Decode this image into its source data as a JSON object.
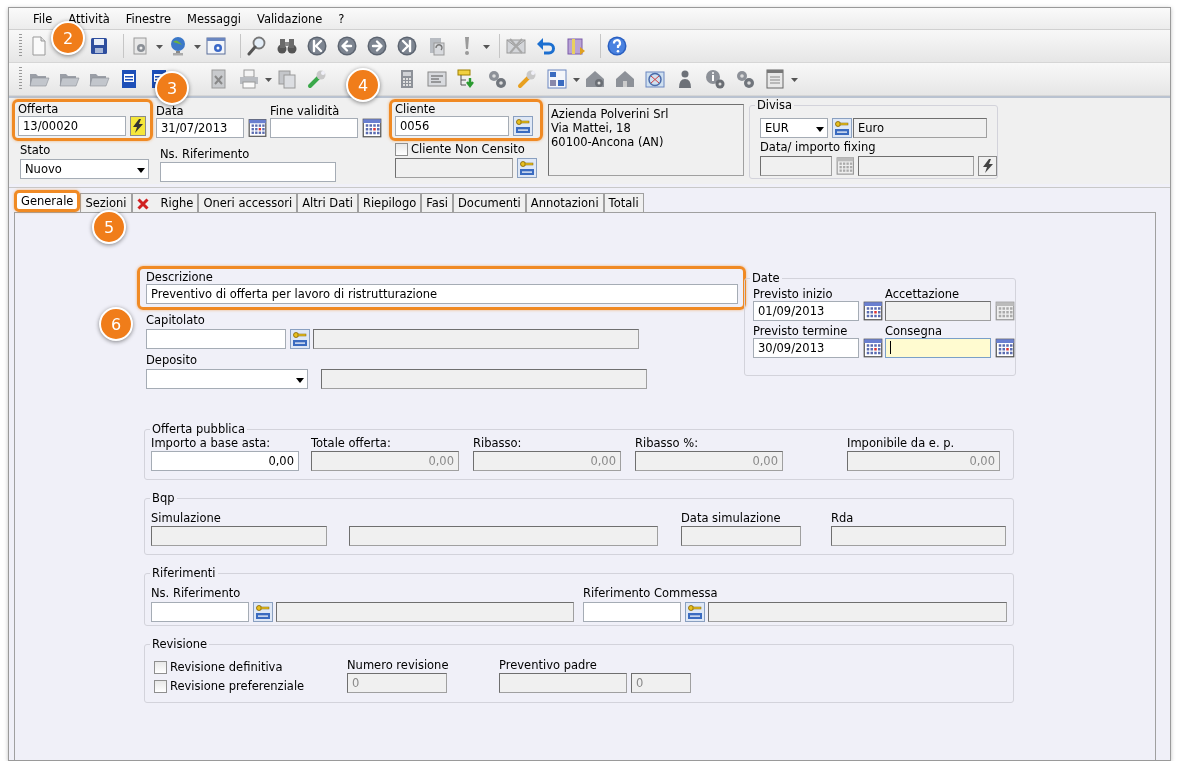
{
  "menu": [
    {
      "label": "File"
    },
    {
      "label": "Attività"
    },
    {
      "label": "Finestre"
    },
    {
      "label": "Messaggi"
    },
    {
      "label": "Validazione"
    },
    {
      "label": "?"
    }
  ],
  "header": {
    "offerta": {
      "label": "Offerta",
      "value": "13/00020",
      "highlighted": true
    },
    "data": {
      "label": "Data",
      "value": "31/07/2013"
    },
    "fine_validita": {
      "label": "Fine validità"
    },
    "cliente": {
      "label": "Cliente",
      "value": "0056",
      "highlighted": true
    },
    "address": [
      "Azienda Polverini Srl",
      "Via Mattei, 18",
      "60100-Ancona (AN)"
    ],
    "stato": {
      "label": "Stato",
      "value": "Nuovo"
    },
    "ns_riferimento": {
      "label": "Ns. Riferimento"
    },
    "cliente_non_censito": {
      "label": "Cliente Non Censito",
      "checked": false
    },
    "divisa": {
      "title": "Divisa",
      "currency": "EUR",
      "currency_name": "Euro",
      "fixing_label": "Data/ importo fixing"
    }
  },
  "tabs": [
    {
      "label": "Generale",
      "selected": true,
      "highlighted": true
    },
    {
      "label": "Sezioni",
      "selected": false,
      "highlighted": false
    },
    {
      "label": "Righe",
      "selected": false,
      "highlighted": false,
      "kind": "delete"
    },
    {
      "label": "Oneri accessori",
      "selected": false,
      "highlighted": false
    },
    {
      "label": "Altri Dati",
      "selected": false,
      "highlighted": false
    },
    {
      "label": "Riepilogo",
      "selected": false,
      "highlighted": false
    },
    {
      "label": "Fasi",
      "selected": false,
      "highlighted": false
    },
    {
      "label": "Documenti",
      "selected": false,
      "highlighted": false
    },
    {
      "label": "Annotazioni",
      "selected": false,
      "highlighted": false
    },
    {
      "label": "Totali",
      "selected": false,
      "highlighted": false
    }
  ],
  "general": {
    "descrizione": {
      "label": "Descrizione",
      "value": "Preventivo di offerta per lavoro di ristrutturazione",
      "highlighted": true
    },
    "capitolato": {
      "label": "Capitolato"
    },
    "deposito": {
      "label": "Deposito"
    },
    "date": {
      "title": "Date",
      "fields": [
        {
          "label": "Previsto inizio",
          "value": "01/09/2013",
          "disabled": false,
          "focused": false
        },
        {
          "label": "Accettazione",
          "disabled": true,
          "focused": false
        },
        {
          "label": "Previsto termine",
          "value": "30/09/2013",
          "disabled": false,
          "focused": false
        },
        {
          "label": "Consegna",
          "disabled": false,
          "focused": true
        }
      ]
    },
    "offerta_pubblica": {
      "title": "Offerta pubblica",
      "fields": [
        {
          "label": "Importo a base asta:",
          "value": "0,00",
          "disabled": false
        },
        {
          "label": "Totale offerta:",
          "value": "0,00",
          "disabled": true
        },
        {
          "label": "Ribasso:",
          "value": "0,00",
          "disabled": true
        },
        {
          "label": "Ribasso %:",
          "value": "0,00",
          "disabled": true
        },
        {
          "label": "Imponibile da e. p.",
          "value": "0,00",
          "disabled": true
        }
      ]
    },
    "bqp": {
      "title": "Bqp",
      "simulazione": "Simulazione",
      "data_simulazione": "Data simulazione",
      "rda": "Rda"
    },
    "riferimenti": {
      "title": "Riferimenti",
      "ns_riferimento": "Ns. Riferimento",
      "riferimento_commessa": "Riferimento Commessa"
    },
    "revisione": {
      "title": "Revisione",
      "checks": [
        {
          "label": "Revisione definitiva",
          "checked": false
        },
        {
          "label": "Revisione preferenziale",
          "checked": false
        }
      ],
      "numero_revisione": {
        "label": "Numero revisione",
        "value": "0"
      },
      "preventivo_padre": {
        "label": "Preventivo padre",
        "value": "0"
      }
    }
  },
  "callouts": [
    "2",
    "3",
    "4",
    "5",
    "6"
  ]
}
